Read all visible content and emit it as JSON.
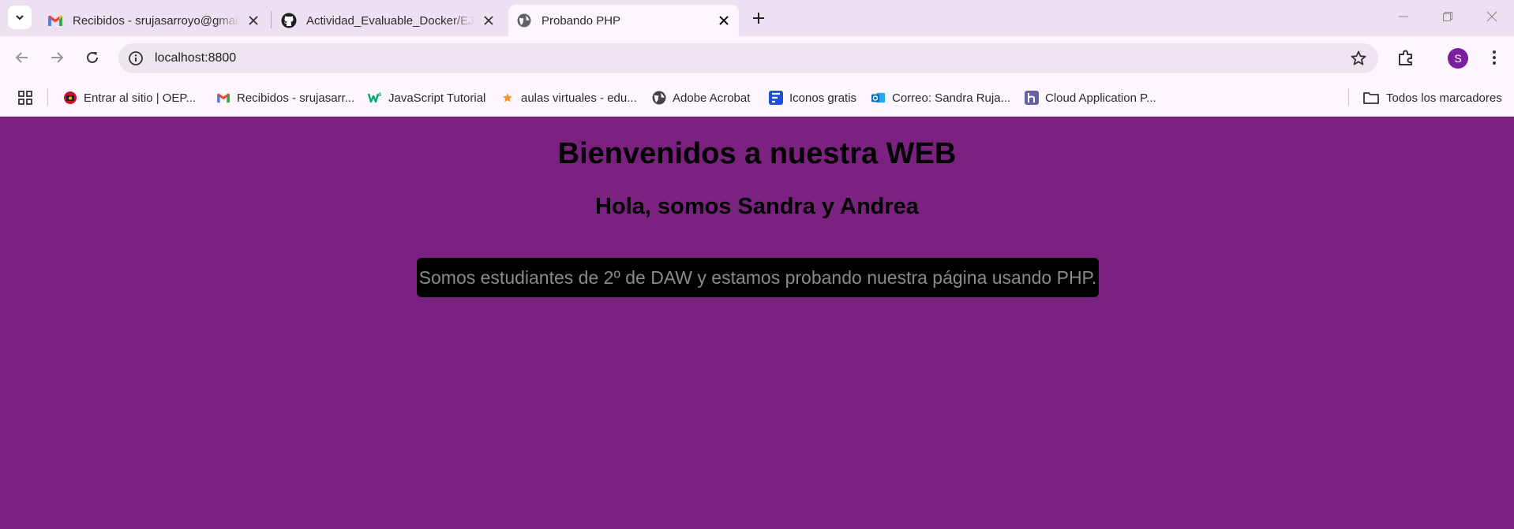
{
  "browser": {
    "tabs": [
      {
        "title": "Recibidos - srujasarroyo@gmail.com",
        "icon": "gmail-icon",
        "active": false
      },
      {
        "title": "Actividad_Evaluable_Docker/EJE",
        "icon": "github-icon",
        "active": false
      },
      {
        "title": "Probando PHP",
        "icon": "globe-icon",
        "active": true
      }
    ],
    "address_bar": {
      "url": "localhost:8800"
    },
    "profile_initial": "S",
    "bookmarks": [
      {
        "label": "Entrar al sitio | OEP...",
        "icon": "oep-icon"
      },
      {
        "label": "Recibidos - srujasarr...",
        "icon": "gmail-icon"
      },
      {
        "label": "JavaScript Tutorial",
        "icon": "w3schools-icon"
      },
      {
        "label": "aulas virtuales - edu...",
        "icon": "star-icon"
      },
      {
        "label": "Adobe Acrobat",
        "icon": "globe-icon"
      },
      {
        "label": "Iconos gratis",
        "icon": "flaticon-icon"
      },
      {
        "label": "Correo: Sandra Ruja...",
        "icon": "outlook-icon"
      },
      {
        "label": "Cloud Application P...",
        "icon": "heroku-icon"
      }
    ],
    "all_bookmarks_label": "Todos los marcadores"
  },
  "page": {
    "heading": "Bienvenidos a nuestra WEB",
    "subheading": "Hola, somos Sandra y Andrea",
    "message": "Somos estudiantes de 2º de DAW y estamos probando nuestra página usando PHP.",
    "colors": {
      "background": "#7b2180",
      "message_box": "#000000",
      "message_text": "#8a8a8a"
    }
  }
}
